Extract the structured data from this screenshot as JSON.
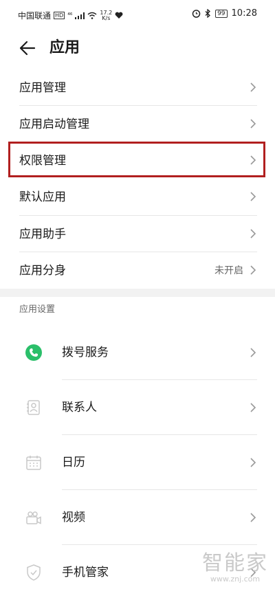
{
  "status_bar": {
    "carrier": "中国联通",
    "hd_badge": "HD",
    "network": "⁴⁶",
    "speed_value": "17.2",
    "speed_unit": "K/s",
    "battery": "99",
    "time": "10:28"
  },
  "header": {
    "title": "应用"
  },
  "menu": {
    "items": [
      {
        "label": "应用管理"
      },
      {
        "label": "应用启动管理"
      },
      {
        "label": "权限管理",
        "highlighted": true
      },
      {
        "label": "默认应用"
      },
      {
        "label": "应用助手"
      },
      {
        "label": "应用分身",
        "value": "未开启"
      }
    ]
  },
  "settings": {
    "title": "应用设置",
    "items": [
      {
        "label": "拨号服务",
        "icon": "phone-icon"
      },
      {
        "label": "联系人",
        "icon": "contacts-icon"
      },
      {
        "label": "日历",
        "icon": "calendar-icon"
      },
      {
        "label": "视频",
        "icon": "video-icon"
      },
      {
        "label": "手机管家",
        "icon": "shield-icon"
      }
    ]
  },
  "watermark": {
    "main": "智能家",
    "sub": "www.znj.com"
  },
  "colors": {
    "highlight": "#b11f1f",
    "phone_green": "#2bbf6a",
    "section_gap": "#f2f2f2"
  }
}
